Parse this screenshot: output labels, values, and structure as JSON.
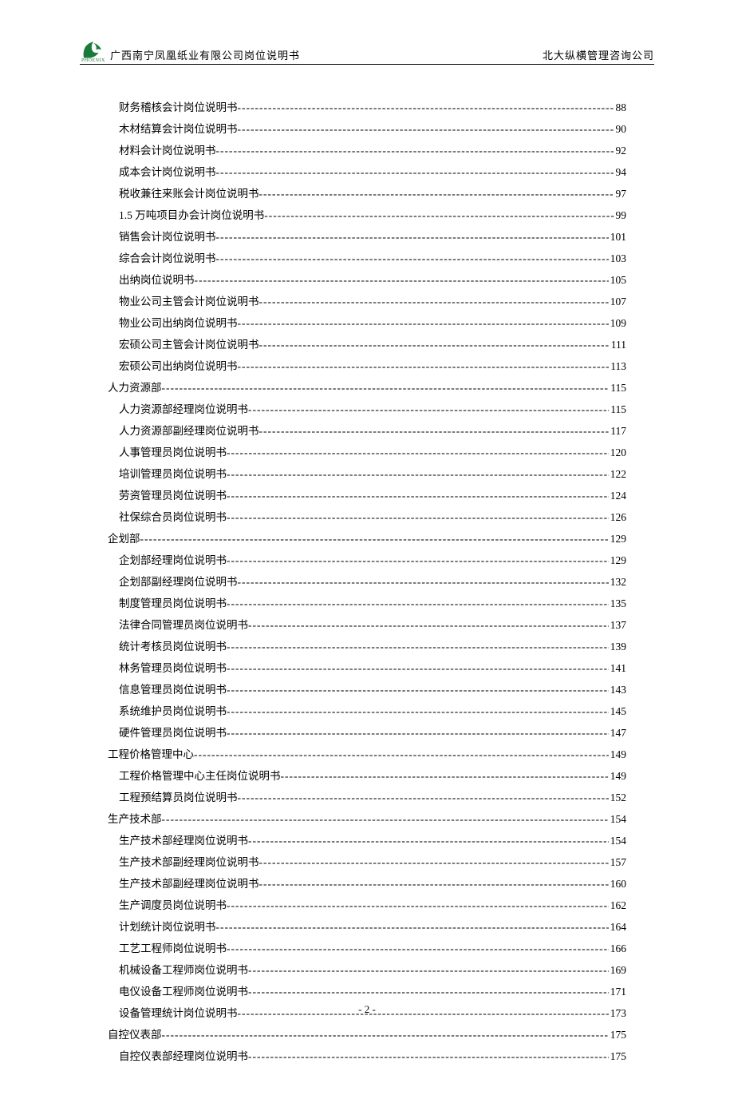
{
  "header": {
    "logo_text": "PHOENIX",
    "left_title": "广西南宁凤凰纸业有限公司岗位说明书",
    "right_title": "北大纵横管理咨询公司"
  },
  "toc": [
    {
      "level": 2,
      "title": "财务稽核会计岗位说明书",
      "page": "88"
    },
    {
      "level": 2,
      "title": "木材结算会计岗位说明书",
      "page": "90"
    },
    {
      "level": 2,
      "title": "材料会计岗位说明书",
      "page": "92"
    },
    {
      "level": 2,
      "title": "成本会计岗位说明书",
      "page": "94"
    },
    {
      "level": 2,
      "title": "税收兼往来账会计岗位说明书",
      "page": "97"
    },
    {
      "level": 2,
      "title": "1.5 万吨项目办会计岗位说明书 ",
      "page": "99"
    },
    {
      "level": 2,
      "title": "销售会计岗位说明书 ",
      "page": "101"
    },
    {
      "level": 2,
      "title": "综合会计岗位说明书 ",
      "page": "103"
    },
    {
      "level": 2,
      "title": "出纳岗位说明书 ",
      "page": "105"
    },
    {
      "level": 2,
      "title": "物业公司主管会计岗位说明书 ",
      "page": "107"
    },
    {
      "level": 2,
      "title": "物业公司出纳岗位说明书 ",
      "page": "109"
    },
    {
      "level": 2,
      "title": "宏硕公司主管会计岗位说明书 ",
      "page": "111"
    },
    {
      "level": 2,
      "title": "宏硕公司出纳岗位说明书 ",
      "page": "113"
    },
    {
      "level": 1,
      "title": "人力资源部 ",
      "page": "115"
    },
    {
      "level": 2,
      "title": "人力资源部经理岗位说明书 ",
      "page": "115"
    },
    {
      "level": 2,
      "title": "人力资源部副经理岗位说明书 ",
      "page": "117"
    },
    {
      "level": 2,
      "title": "人事管理员岗位说明书 ",
      "page": "120"
    },
    {
      "level": 2,
      "title": "培训管理员岗位说明书 ",
      "page": "122"
    },
    {
      "level": 2,
      "title": "劳资管理员岗位说明书 ",
      "page": "124"
    },
    {
      "level": 2,
      "title": "社保综合员岗位说明书 ",
      "page": "126"
    },
    {
      "level": 1,
      "title": "企划部 ",
      "page": "129"
    },
    {
      "level": 2,
      "title": "企划部经理岗位说明书 ",
      "page": "129"
    },
    {
      "level": 2,
      "title": "企划部副经理岗位说明书 ",
      "page": "132"
    },
    {
      "level": 2,
      "title": "制度管理员岗位说明书 ",
      "page": "135"
    },
    {
      "level": 2,
      "title": "法律合同管理员岗位说明书 ",
      "page": "137"
    },
    {
      "level": 2,
      "title": "统计考核员岗位说明书 ",
      "page": "139"
    },
    {
      "level": 2,
      "title": "林务管理员岗位说明书 ",
      "page": "141"
    },
    {
      "level": 2,
      "title": "信息管理员岗位说明书 ",
      "page": "143"
    },
    {
      "level": 2,
      "title": "系统维护员岗位说明书 ",
      "page": "145"
    },
    {
      "level": 2,
      "title": "硬件管理员岗位说明书 ",
      "page": "147"
    },
    {
      "level": 1,
      "title": "工程价格管理中心 ",
      "page": "149"
    },
    {
      "level": 2,
      "title": "工程价格管理中心主任岗位说明书 ",
      "page": "149"
    },
    {
      "level": 2,
      "title": "工程预结算员岗位说明书 ",
      "page": "152"
    },
    {
      "level": 1,
      "title": "生产技术部 ",
      "page": "154"
    },
    {
      "level": 2,
      "title": "生产技术部经理岗位说明书 ",
      "page": "154"
    },
    {
      "level": 2,
      "title": "生产技术部副经理岗位说明书 ",
      "page": "157"
    },
    {
      "level": 2,
      "title": "生产技术部副经理岗位说明书 ",
      "page": "160"
    },
    {
      "level": 2,
      "title": "生产调度员岗位说明书 ",
      "page": "162"
    },
    {
      "level": 2,
      "title": "计划统计岗位说明书 ",
      "page": "164"
    },
    {
      "level": 2,
      "title": "工艺工程师岗位说明书 ",
      "page": "166"
    },
    {
      "level": 2,
      "title": "机械设备工程师岗位说明书 ",
      "page": "169"
    },
    {
      "level": 2,
      "title": "电仪设备工程师岗位说明书 ",
      "page": "171"
    },
    {
      "level": 2,
      "title": "设备管理统计岗位说明书 ",
      "page": "173"
    },
    {
      "level": 1,
      "title": "自控仪表部 ",
      "page": "175"
    },
    {
      "level": 2,
      "title": "自控仪表部经理岗位说明书 ",
      "page": "175"
    }
  ],
  "footer": {
    "page_number": "- 2 -"
  }
}
